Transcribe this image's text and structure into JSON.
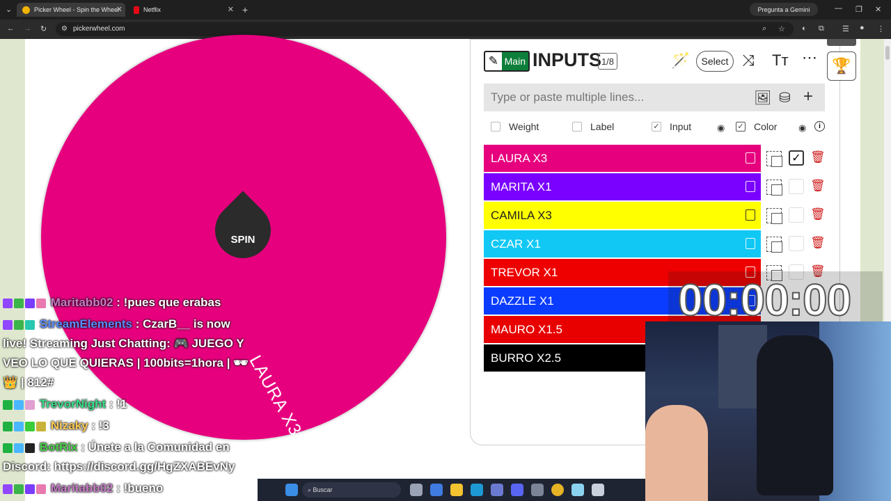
{
  "browser": {
    "tabs": [
      {
        "title": "Picker Wheel - Spin the Wheel",
        "active": true
      },
      {
        "title": "Netflix",
        "active": false
      }
    ],
    "gemini_label": "Pregunta a Gemini",
    "url": "pickerwheel.com"
  },
  "wheel": {
    "color": "#e6007e",
    "spin_label": "SPIN",
    "segment_label": "LAURA X3"
  },
  "panel": {
    "main_label": "Main",
    "title": "INPUTS",
    "count": "1/8",
    "select_label": "Select",
    "entry_placeholder": "Type or paste multiple lines...",
    "options": [
      {
        "label": "Weight",
        "checked": false
      },
      {
        "label": "Label",
        "checked": false
      },
      {
        "label": "Input",
        "checked": true
      },
      {
        "label": "Color",
        "checked": true
      }
    ],
    "rows": [
      {
        "label": "LAURA X3",
        "bg": "#e6007e",
        "fg": "#ffffff",
        "selected": true
      },
      {
        "label": "MARITA X1",
        "bg": "#7a00ff",
        "fg": "#ffffff",
        "selected": false
      },
      {
        "label": "CAMILA X3",
        "bg": "#ffff00",
        "fg": "#222222",
        "selected": false
      },
      {
        "label": "CZAR X1",
        "bg": "#11c8f5",
        "fg": "#ffffff",
        "selected": false
      },
      {
        "label": "TREVOR X1",
        "bg": "#ee0000",
        "fg": "#ffffff",
        "selected": false
      },
      {
        "label": "DAZZLE X1",
        "bg": "#0a3cff",
        "fg": "#ffffff",
        "selected": false
      },
      {
        "label": "MAURO X1.5",
        "bg": "#e80000",
        "fg": "#ffffff",
        "selected": false
      },
      {
        "label": "BURRO X2.5",
        "bg": "#000000",
        "fg": "#ffffff",
        "selected": false
      }
    ]
  },
  "overlay": {
    "timer": "00:00:00",
    "taskbar_search": "Buscar",
    "chat": [
      {
        "user": "Maritabb02",
        "user_color": "#c77dc7",
        "text": ": !pues que erabas"
      },
      {
        "user": "StreamElements",
        "user_color": "#5b8cff",
        "text": ": CzarB__ is now"
      },
      {
        "user": "",
        "user_color": "#ffffff",
        "text": "live! Streaming Just Chatting: 🎮 JUEGO Y"
      },
      {
        "user": "",
        "user_color": "#ffffff",
        "text": "VEO LO QUE QUIERAS | 100bits=1hora | 🕶"
      },
      {
        "user": "",
        "user_color": "#ffffff",
        "text": "👑 | 812#"
      },
      {
        "user": "TrevorNight",
        "user_color": "#39e08a",
        "text": ": !1"
      },
      {
        "user": "Nizaky",
        "user_color": "#ffcc55",
        "text": ": !3"
      },
      {
        "user": "BotRix",
        "user_color": "#4cd14c",
        "text": ": Únete a la Comunidad en"
      },
      {
        "user": "",
        "user_color": "#ffffff",
        "text": "Discord: https://discord.gg/HgZXABEvNy"
      },
      {
        "user": "Maritabb02",
        "user_color": "#c77dc7",
        "text": ": !bueno"
      }
    ]
  }
}
